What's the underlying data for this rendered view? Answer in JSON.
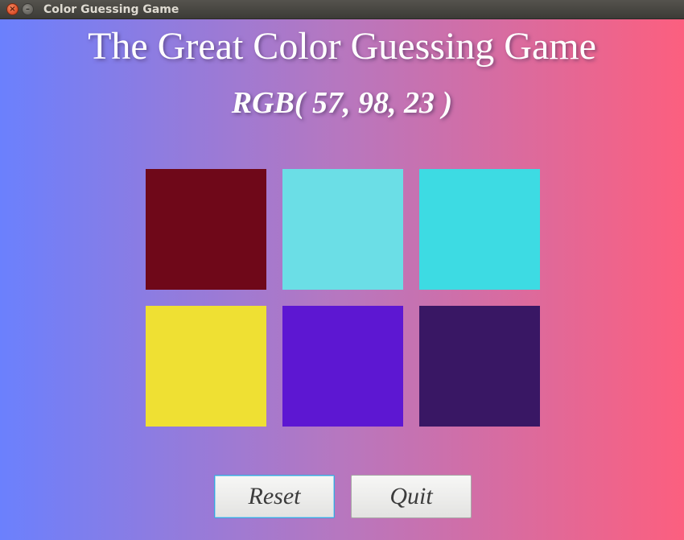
{
  "window": {
    "title": "Color Guessing Game",
    "close_symbol": "×",
    "minimize_symbol": "–"
  },
  "game": {
    "title": "The Great Color Guessing Game",
    "target_rgb_text": "RGB( 57, 98, 23 )"
  },
  "swatches": [
    {
      "color": "#6f0819"
    },
    {
      "color": "#6bdee6"
    },
    {
      "color": "#3ddbe3"
    },
    {
      "color": "#efe033"
    },
    {
      "color": "#5d17d2"
    },
    {
      "color": "#391764"
    }
  ],
  "buttons": {
    "reset_label": "Reset",
    "quit_label": "Quit",
    "focused": "reset"
  },
  "colors": {
    "gradient_left": "#6b80fd",
    "gradient_right": "#fc5f7f"
  }
}
